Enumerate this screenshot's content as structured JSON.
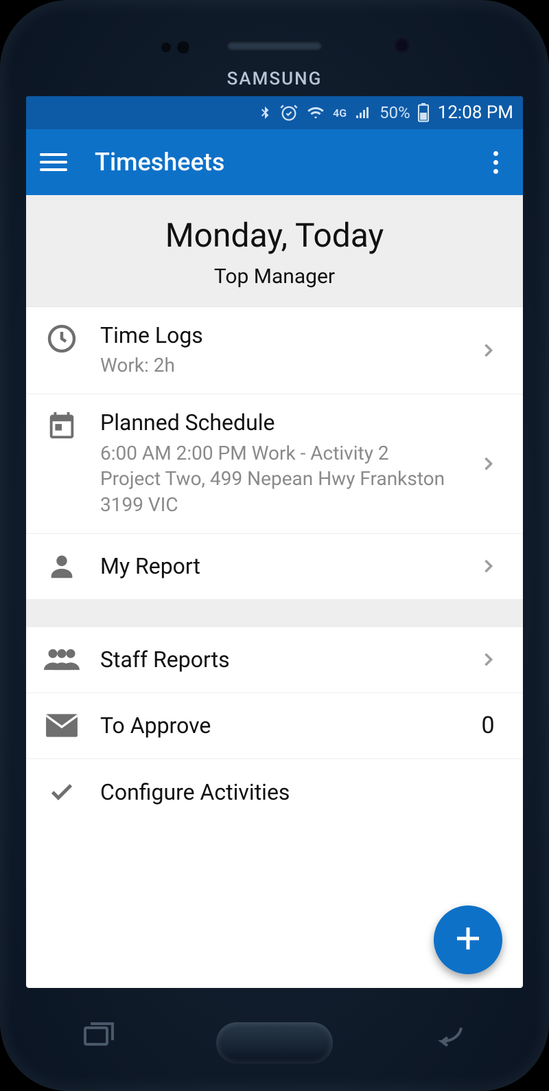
{
  "device": {
    "brand": "SAMSUNG"
  },
  "status_bar": {
    "battery_percent": "50%",
    "time": "12:08 PM",
    "network_label": "4G"
  },
  "app_bar": {
    "title": "Timesheets"
  },
  "header": {
    "date_label": "Monday, Today",
    "role_label": "Top Manager"
  },
  "section1": [
    {
      "id": "time-logs",
      "title": "Time Logs",
      "subtitle": "Work: 2h",
      "chevron": true
    },
    {
      "id": "planned-schedule",
      "title": "Planned Schedule",
      "subtitle": "6:00 AM 2:00 PM Work - Activity 2 Project Two, 499 Nepean Hwy Frankston 3199 VIC",
      "chevron": true
    },
    {
      "id": "my-report",
      "title": "My Report",
      "chevron": true
    }
  ],
  "section2": [
    {
      "id": "staff-reports",
      "title": "Staff Reports",
      "chevron": true
    },
    {
      "id": "to-approve",
      "title": "To Approve",
      "count": "0"
    },
    {
      "id": "configure-activities",
      "title": "Configure Activities"
    }
  ]
}
